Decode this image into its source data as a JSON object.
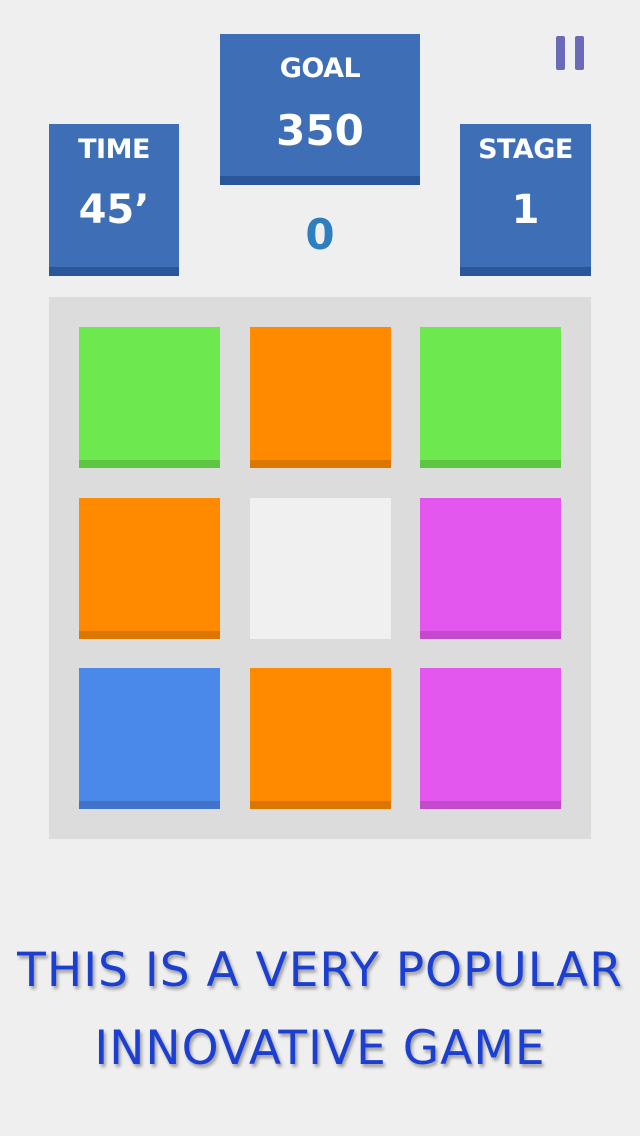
{
  "hud": {
    "time": {
      "label": "TIME",
      "value": "45’"
    },
    "goal": {
      "label": "GOAL",
      "value": "350"
    },
    "stage": {
      "label": "STAGE",
      "value": "1"
    },
    "score": "0"
  },
  "colors": {
    "green": "#6de84e",
    "orange": "#ff8a00",
    "purple": "#e357ee",
    "blue": "#4a88ea",
    "empty": "#f0f0f0",
    "panel": "#3e6fb6",
    "promo_text": "#1b3fd1"
  },
  "board": {
    "rows": 3,
    "cols": 3,
    "tiles": [
      [
        "green",
        "orange",
        "green"
      ],
      [
        "orange",
        "empty",
        "purple"
      ],
      [
        "blue",
        "orange",
        "purple"
      ]
    ]
  },
  "pause_icon": "pause-icon",
  "promo": {
    "line1": "THIS IS A VERY POPULAR",
    "line2": "INNOVATIVE GAME"
  }
}
